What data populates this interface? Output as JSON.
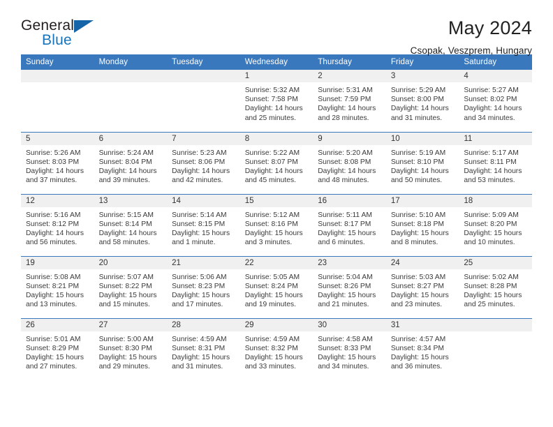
{
  "brand": {
    "name_part1": "General",
    "name_part2": "Blue",
    "accent_color": "#1574bb",
    "triangle_color": "#1565a8"
  },
  "header": {
    "title": "May 2024",
    "subtitle": "Csopak, Veszprem, Hungary"
  },
  "theme": {
    "header_row_bg": "#3a78bd",
    "daynum_bg": "#f0f0f0",
    "text": "#3a3a3a"
  },
  "calendar": {
    "weekday_headers": [
      "Sunday",
      "Monday",
      "Tuesday",
      "Wednesday",
      "Thursday",
      "Friday",
      "Saturday"
    ],
    "weeks": [
      [
        {
          "day": "",
          "lines": []
        },
        {
          "day": "",
          "lines": []
        },
        {
          "day": "",
          "lines": []
        },
        {
          "day": "1",
          "lines": [
            "Sunrise: 5:32 AM",
            "Sunset: 7:58 PM",
            "Daylight: 14 hours and 25 minutes."
          ]
        },
        {
          "day": "2",
          "lines": [
            "Sunrise: 5:31 AM",
            "Sunset: 7:59 PM",
            "Daylight: 14 hours and 28 minutes."
          ]
        },
        {
          "day": "3",
          "lines": [
            "Sunrise: 5:29 AM",
            "Sunset: 8:00 PM",
            "Daylight: 14 hours and 31 minutes."
          ]
        },
        {
          "day": "4",
          "lines": [
            "Sunrise: 5:27 AM",
            "Sunset: 8:02 PM",
            "Daylight: 14 hours and 34 minutes."
          ]
        }
      ],
      [
        {
          "day": "5",
          "lines": [
            "Sunrise: 5:26 AM",
            "Sunset: 8:03 PM",
            "Daylight: 14 hours and 37 minutes."
          ]
        },
        {
          "day": "6",
          "lines": [
            "Sunrise: 5:24 AM",
            "Sunset: 8:04 PM",
            "Daylight: 14 hours and 39 minutes."
          ]
        },
        {
          "day": "7",
          "lines": [
            "Sunrise: 5:23 AM",
            "Sunset: 8:06 PM",
            "Daylight: 14 hours and 42 minutes."
          ]
        },
        {
          "day": "8",
          "lines": [
            "Sunrise: 5:22 AM",
            "Sunset: 8:07 PM",
            "Daylight: 14 hours and 45 minutes."
          ]
        },
        {
          "day": "9",
          "lines": [
            "Sunrise: 5:20 AM",
            "Sunset: 8:08 PM",
            "Daylight: 14 hours and 48 minutes."
          ]
        },
        {
          "day": "10",
          "lines": [
            "Sunrise: 5:19 AM",
            "Sunset: 8:10 PM",
            "Daylight: 14 hours and 50 minutes."
          ]
        },
        {
          "day": "11",
          "lines": [
            "Sunrise: 5:17 AM",
            "Sunset: 8:11 PM",
            "Daylight: 14 hours and 53 minutes."
          ]
        }
      ],
      [
        {
          "day": "12",
          "lines": [
            "Sunrise: 5:16 AM",
            "Sunset: 8:12 PM",
            "Daylight: 14 hours and 56 minutes."
          ]
        },
        {
          "day": "13",
          "lines": [
            "Sunrise: 5:15 AM",
            "Sunset: 8:14 PM",
            "Daylight: 14 hours and 58 minutes."
          ]
        },
        {
          "day": "14",
          "lines": [
            "Sunrise: 5:14 AM",
            "Sunset: 8:15 PM",
            "Daylight: 15 hours and 1 minute."
          ]
        },
        {
          "day": "15",
          "lines": [
            "Sunrise: 5:12 AM",
            "Sunset: 8:16 PM",
            "Daylight: 15 hours and 3 minutes."
          ]
        },
        {
          "day": "16",
          "lines": [
            "Sunrise: 5:11 AM",
            "Sunset: 8:17 PM",
            "Daylight: 15 hours and 6 minutes."
          ]
        },
        {
          "day": "17",
          "lines": [
            "Sunrise: 5:10 AM",
            "Sunset: 8:18 PM",
            "Daylight: 15 hours and 8 minutes."
          ]
        },
        {
          "day": "18",
          "lines": [
            "Sunrise: 5:09 AM",
            "Sunset: 8:20 PM",
            "Daylight: 15 hours and 10 minutes."
          ]
        }
      ],
      [
        {
          "day": "19",
          "lines": [
            "Sunrise: 5:08 AM",
            "Sunset: 8:21 PM",
            "Daylight: 15 hours and 13 minutes."
          ]
        },
        {
          "day": "20",
          "lines": [
            "Sunrise: 5:07 AM",
            "Sunset: 8:22 PM",
            "Daylight: 15 hours and 15 minutes."
          ]
        },
        {
          "day": "21",
          "lines": [
            "Sunrise: 5:06 AM",
            "Sunset: 8:23 PM",
            "Daylight: 15 hours and 17 minutes."
          ]
        },
        {
          "day": "22",
          "lines": [
            "Sunrise: 5:05 AM",
            "Sunset: 8:24 PM",
            "Daylight: 15 hours and 19 minutes."
          ]
        },
        {
          "day": "23",
          "lines": [
            "Sunrise: 5:04 AM",
            "Sunset: 8:26 PM",
            "Daylight: 15 hours and 21 minutes."
          ]
        },
        {
          "day": "24",
          "lines": [
            "Sunrise: 5:03 AM",
            "Sunset: 8:27 PM",
            "Daylight: 15 hours and 23 minutes."
          ]
        },
        {
          "day": "25",
          "lines": [
            "Sunrise: 5:02 AM",
            "Sunset: 8:28 PM",
            "Daylight: 15 hours and 25 minutes."
          ]
        }
      ],
      [
        {
          "day": "26",
          "lines": [
            "Sunrise: 5:01 AM",
            "Sunset: 8:29 PM",
            "Daylight: 15 hours and 27 minutes."
          ]
        },
        {
          "day": "27",
          "lines": [
            "Sunrise: 5:00 AM",
            "Sunset: 8:30 PM",
            "Daylight: 15 hours and 29 minutes."
          ]
        },
        {
          "day": "28",
          "lines": [
            "Sunrise: 4:59 AM",
            "Sunset: 8:31 PM",
            "Daylight: 15 hours and 31 minutes."
          ]
        },
        {
          "day": "29",
          "lines": [
            "Sunrise: 4:59 AM",
            "Sunset: 8:32 PM",
            "Daylight: 15 hours and 33 minutes."
          ]
        },
        {
          "day": "30",
          "lines": [
            "Sunrise: 4:58 AM",
            "Sunset: 8:33 PM",
            "Daylight: 15 hours and 34 minutes."
          ]
        },
        {
          "day": "31",
          "lines": [
            "Sunrise: 4:57 AM",
            "Sunset: 8:34 PM",
            "Daylight: 15 hours and 36 minutes."
          ]
        },
        {
          "day": "",
          "lines": []
        }
      ]
    ]
  }
}
